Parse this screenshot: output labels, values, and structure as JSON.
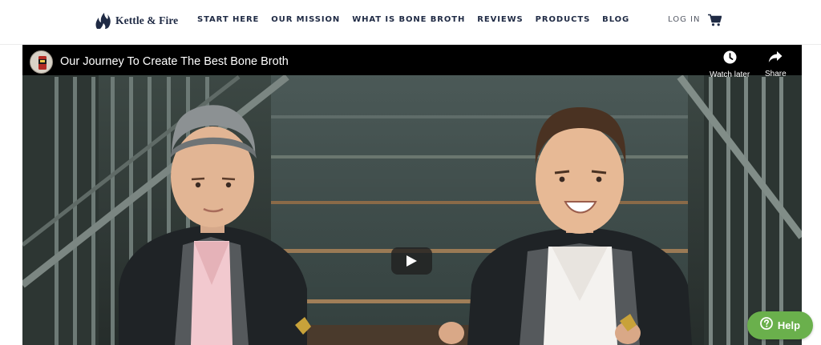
{
  "header": {
    "logo_text": "Kettle & Fire",
    "nav": [
      {
        "label": "START HERE"
      },
      {
        "label": "OUR MISSION"
      },
      {
        "label": "WHAT IS BONE BROTH"
      },
      {
        "label": "REVIEWS"
      },
      {
        "label": "PRODUCTS"
      },
      {
        "label": "BLOG"
      }
    ],
    "login_label": "LOG IN",
    "cart_icon": "shopping-cart-icon"
  },
  "video": {
    "title": "Our Journey To Create The Best Bone Broth",
    "watch_later_label": "Watch later",
    "share_label": "Share",
    "play_icon": "play-icon",
    "channel_icon": "channel-avatar"
  },
  "help": {
    "label": "Help",
    "icon": "question-circle-icon"
  },
  "colors": {
    "brand_navy": "#1f2a44",
    "help_green": "#6ab04c",
    "video_bar": "#000000"
  }
}
